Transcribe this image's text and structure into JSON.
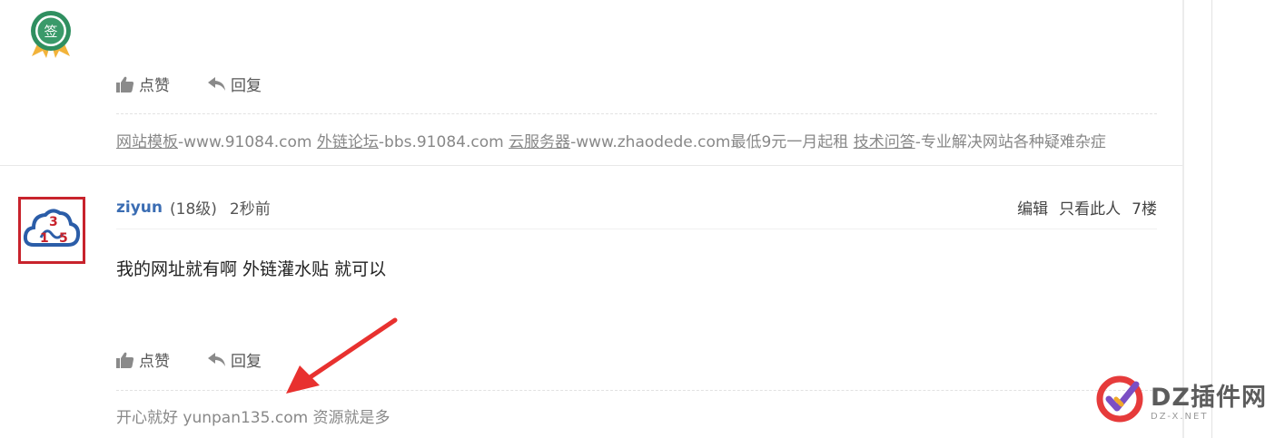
{
  "previous_post": {
    "badge_glyph": "签",
    "actions": {
      "like_label": "点赞",
      "reply_label": "回复"
    },
    "signature": [
      {
        "type": "link",
        "text": "网站模板"
      },
      {
        "type": "text",
        "text": "-www.91084.com "
      },
      {
        "type": "link",
        "text": "外链论坛"
      },
      {
        "type": "text",
        "text": "-bbs.91084.com "
      },
      {
        "type": "link",
        "text": "云服务器"
      },
      {
        "type": "text",
        "text": "-www.zhaodede.com最低9元一月起租 "
      },
      {
        "type": "link",
        "text": "技术问答"
      },
      {
        "type": "text",
        "text": "-专业解决网站各种疑难杂症"
      }
    ]
  },
  "post": {
    "avatar_digits": [
      "1",
      "3",
      "5"
    ],
    "username": "ziyun",
    "level": "(18级)",
    "time": "2秒前",
    "tools": {
      "edit": "编辑",
      "only_author": "只看此人",
      "floor": "7楼"
    },
    "body": "我的网址就有啊 外链灌水贴 就可以",
    "actions": {
      "like_label": "点赞",
      "reply_label": "回复"
    },
    "signature": "开心就好 yunpan135.com 资源就是多"
  },
  "watermark": {
    "brand": "DZ插件网",
    "sub": "DZ-X.NET"
  },
  "colors": {
    "username": "#3b6db3",
    "avatar_border": "#c8232c",
    "arrow": "#e8312f",
    "badge": "#3a9a6a"
  }
}
